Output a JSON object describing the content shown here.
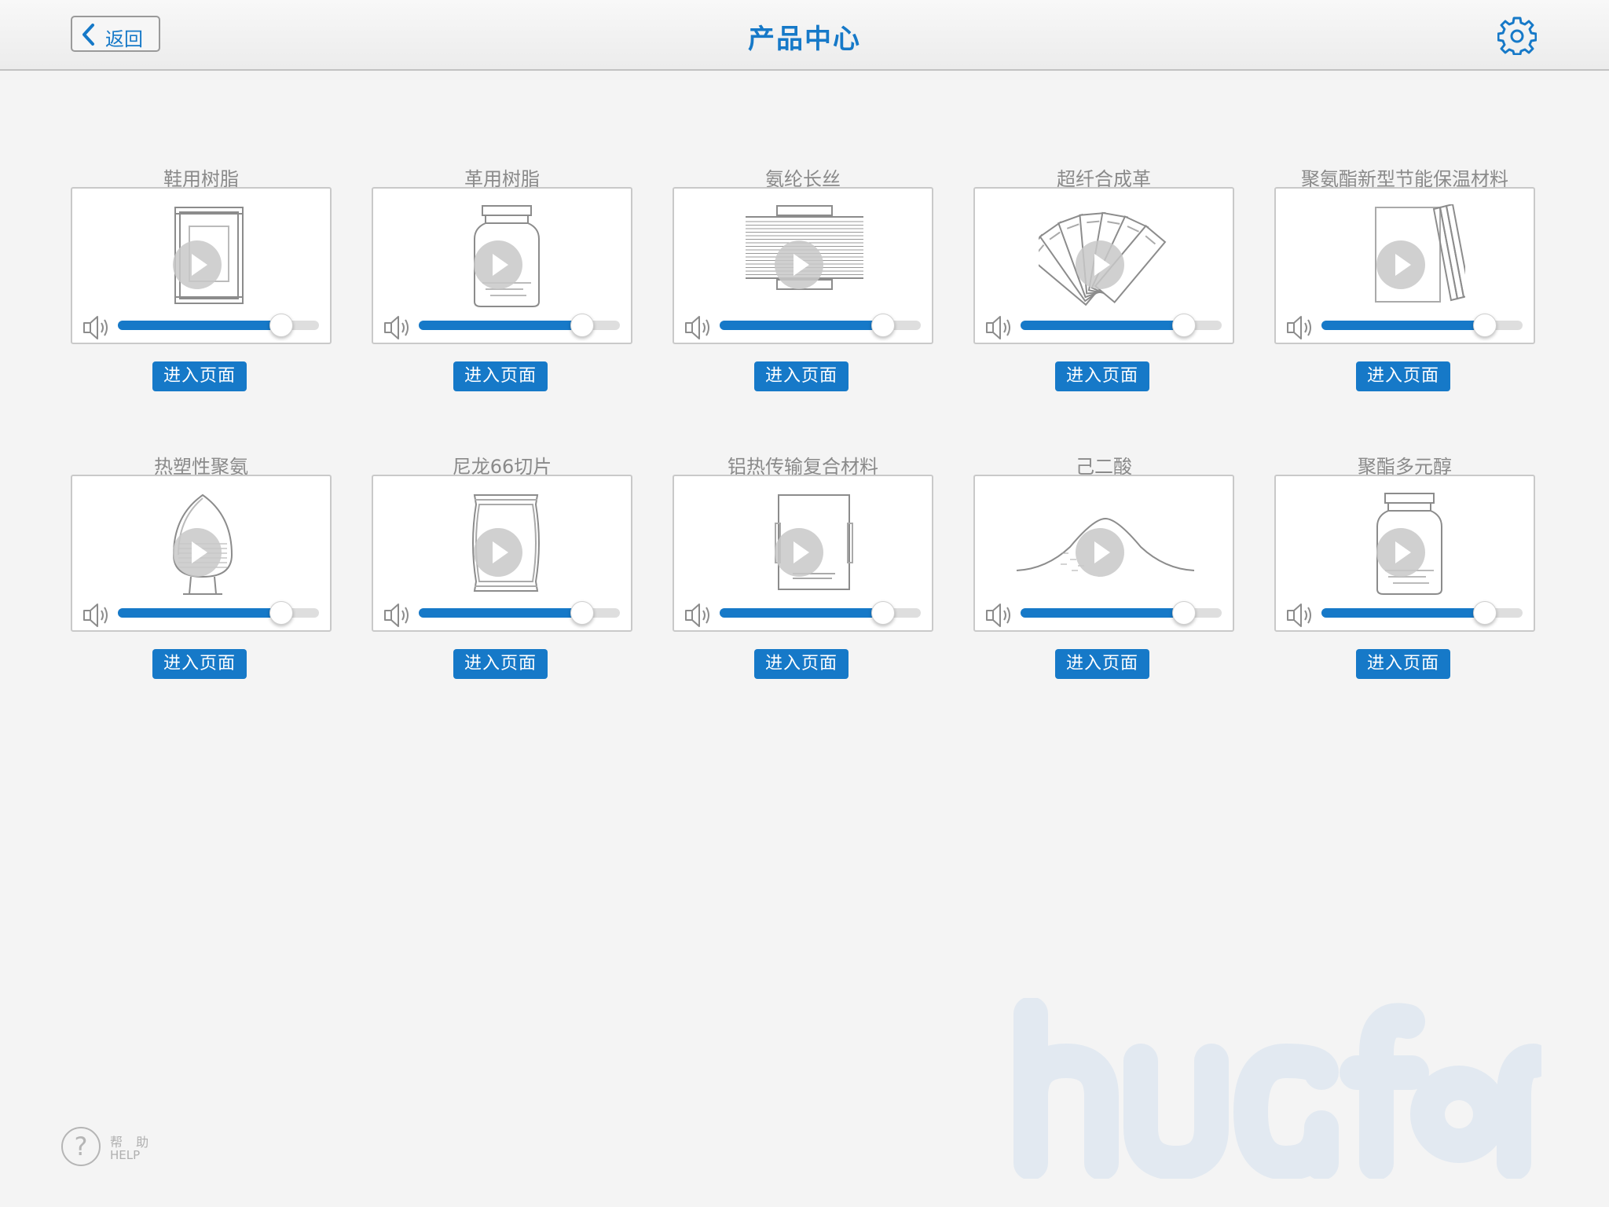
{
  "header": {
    "back_label": "返回",
    "title": "产品中心",
    "settings_icon": "gear-icon"
  },
  "accent_color": "#1679c8",
  "products": [
    {
      "title": "鞋用树脂",
      "art": "framed-panel",
      "volume_percent": 81,
      "button": "进入页面"
    },
    {
      "title": "革用树脂",
      "art": "jar",
      "volume_percent": 81,
      "button": "进入页面"
    },
    {
      "title": "氨纶长丝",
      "art": "spool",
      "volume_percent": 81,
      "button": "进入页面"
    },
    {
      "title": "超纤合成革",
      "art": "fanned-sheets",
      "volume_percent": 81,
      "button": "进入页面"
    },
    {
      "title": "聚氨酯新型节能保温材料",
      "art": "board-stack",
      "volume_percent": 81,
      "button": "进入页面"
    },
    {
      "title": "热塑性聚氨",
      "art": "hopper",
      "volume_percent": 81,
      "button": "进入页面"
    },
    {
      "title": "尼龙66切片",
      "art": "bag",
      "volume_percent": 81,
      "button": "进入页面"
    },
    {
      "title": "铝热传输复合材料",
      "art": "foil-sheet",
      "volume_percent": 81,
      "button": "进入页面"
    },
    {
      "title": "己二酸",
      "art": "powder-pile",
      "volume_percent": 81,
      "button": "进入页面"
    },
    {
      "title": "聚酯多元醇",
      "art": "jar",
      "volume_percent": 81,
      "button": "进入页面"
    }
  ],
  "help": {
    "label_zh": "帮 助",
    "label_en": "HELP",
    "icon": "question-icon"
  },
  "watermark": {
    "brand": "huafon"
  }
}
